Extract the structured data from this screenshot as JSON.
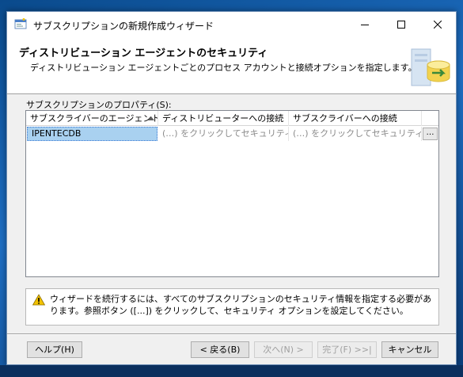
{
  "window": {
    "title": "サブスクリプションの新規作成ウィザード"
  },
  "header": {
    "title": "ディストリビューション エージェントのセキュリティ",
    "subtitle": "ディストリビューション エージェントごとのプロセス アカウントと接続オプションを指定します。"
  },
  "grid": {
    "label": "サブスクリプションのプロパティ(S):",
    "columns": [
      "サブスクライバーのエージェント",
      "ディストリビューターへの接続",
      "サブスクライバーへの接続"
    ],
    "rows": [
      {
        "agent": "IPENTECDB",
        "distributor": "(…) をクリックしてセキュリティ…",
        "subscriber": "(…) をクリックしてセキュリティ…",
        "button": "…"
      }
    ]
  },
  "warning": {
    "text": "ウィザードを続行するには、すべてのサブスクリプションのセキュリティ情報を指定する必要があります。参照ボタン ([...]) をクリックして、セキュリティ オプションを設定してください。"
  },
  "buttons": {
    "help": "ヘルプ(H)",
    "back": "< 戻る(B)",
    "next": "次へ(N) >",
    "finish": "完了(F) >>|",
    "cancel": "キャンセル"
  },
  "colors": {
    "selection": "#a9d1f0",
    "disabled_text": "#a0a0a0",
    "warning_icon": "#f2c200"
  }
}
